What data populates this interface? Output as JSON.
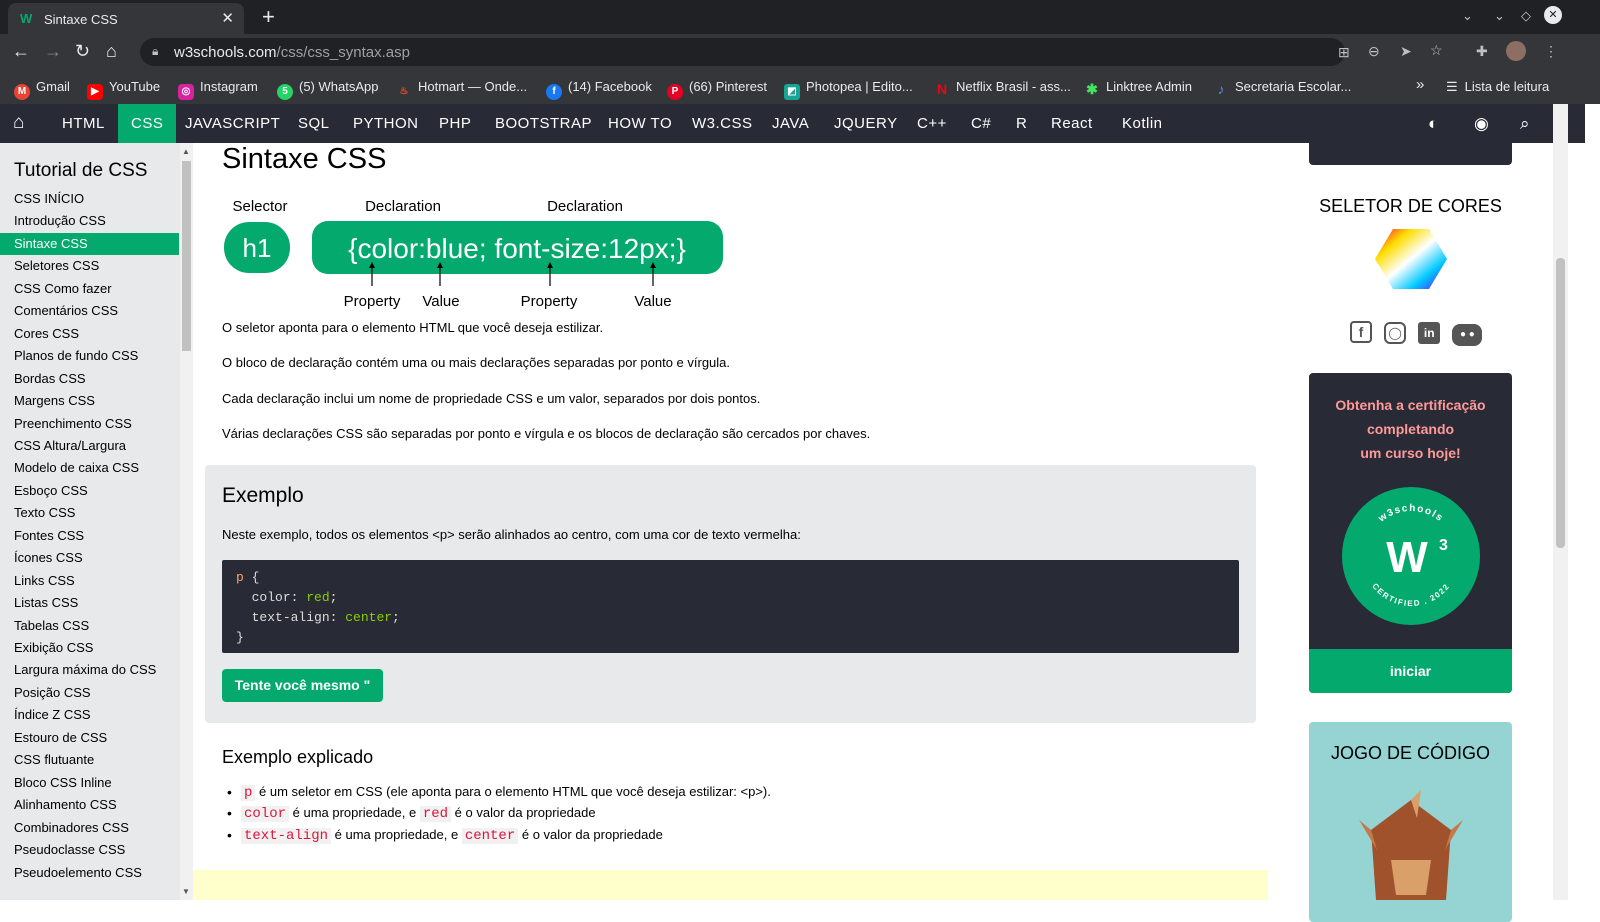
{
  "browser": {
    "tab_title": "Sintaxe CSS",
    "tab_favicon": "W",
    "tab_close": "✕",
    "new_tab": "+",
    "url_domain": "w3schools.com",
    "url_path": "/css/css_syntax.asp",
    "reading_list": "Lista de leitura",
    "bookmarks_more": "»"
  },
  "bookmarks": [
    {
      "label": "Gmail",
      "icon": "gmail-icon",
      "color": "#ea4335",
      "glyph": "M"
    },
    {
      "label": "YouTube",
      "icon": "youtube-icon",
      "color": "#ff0000",
      "glyph": "▶"
    },
    {
      "label": "Instagram",
      "icon": "instagram-icon",
      "color": "#d6249f",
      "glyph": "◎"
    },
    {
      "label": "(5) WhatsApp",
      "icon": "whatsapp-icon",
      "color": "#25d366",
      "glyph": "5"
    },
    {
      "label": "Hotmart — Onde...",
      "icon": "hotmart-icon",
      "color": "#f04e23",
      "glyph": "♨"
    },
    {
      "label": "(14) Facebook",
      "icon": "facebook-icon",
      "color": "#1877f2",
      "glyph": "f"
    },
    {
      "label": "(66) Pinterest",
      "icon": "pinterest-icon",
      "color": "#e60023",
      "glyph": "P"
    },
    {
      "label": "Photopea | Edito...",
      "icon": "photopea-icon",
      "color": "#18a497",
      "glyph": "◩"
    },
    {
      "label": "Netflix Brasil - ass...",
      "icon": "netflix-icon",
      "color": "#e50914",
      "glyph": "N"
    },
    {
      "label": "Linktree Admin",
      "icon": "linktree-icon",
      "color": "#43e660",
      "glyph": "✱"
    },
    {
      "label": "Secretaria Escolar...",
      "icon": "secretaria-icon",
      "color": "#4a90e2",
      "glyph": "♪"
    }
  ],
  "topnav": {
    "items": [
      "HTML",
      "CSS",
      "JAVASCRIPT",
      "SQL",
      "PYTHON",
      "PHP",
      "BOOTSTRAP",
      "HOW TO",
      "W3.CSS",
      "JAVA",
      "JQUERY",
      "C++",
      "C#",
      "R",
      "React",
      "Kotlin"
    ],
    "active": "CSS"
  },
  "sidebar": {
    "title": "Tutorial de CSS",
    "items": [
      "CSS INÍCIO",
      "Introdução CSS",
      "Sintaxe CSS",
      "Seletores CSS",
      "CSS Como fazer",
      "Comentários CSS",
      "Cores CSS",
      "Planos de fundo CSS",
      "Bordas CSS",
      "Margens CSS",
      "Preenchimento CSS",
      "CSS Altura/Largura",
      "Modelo de caixa CSS",
      "Esboço CSS",
      "Texto CSS",
      "Fontes CSS",
      "Ícones CSS",
      "Links CSS",
      "Listas CSS",
      "Tabelas CSS",
      "Exibição CSS",
      "Largura máxima do CSS",
      "Posição CSS",
      "Índice Z CSS",
      "Estouro de CSS",
      "CSS flutuante",
      "Bloco CSS Inline",
      "Alinhamento CSS",
      "Combinadores CSS",
      "Pseudoclasse CSS",
      "Pseudoelemento CSS"
    ],
    "active": "Sintaxe CSS"
  },
  "main": {
    "title": "Sintaxe CSS",
    "diagram": {
      "selector_label": "Selector",
      "declaration_label_1": "Declaration",
      "declaration_label_2": "Declaration",
      "selector": "h1",
      "block": "{color:blue; font-size:12px;}",
      "property_1": "Property",
      "value_1": "Value",
      "property_2": "Property",
      "value_2": "Value",
      "green": "#04aa6d"
    },
    "paragraphs": [
      "O seletor aponta para o elemento HTML que você deseja estilizar.",
      "O bloco de declaração contém uma ou mais declarações separadas por ponto e vírgula.",
      "Cada declaração inclui um nome de propriedade CSS e um valor, separados por dois pontos.",
      "Várias declarações CSS são separadas por ponto e vírgula e os blocos de declaração são cercados por chaves."
    ],
    "example": {
      "title": "Exemplo",
      "description": "Neste exemplo, todos os elementos <p> serão alinhados ao centro, com uma cor de texto vermelha:",
      "code_selector": "p",
      "code_open": " {",
      "line1_prop": "color",
      "line1_val": "red",
      "line2_prop": "text-align",
      "line2_val": "center",
      "code_close": "}",
      "try_button": "Tente você mesmo \""
    },
    "explained": {
      "title": "Exemplo explicado",
      "item1_kw": "p",
      "item1_text": " é um seletor em CSS (ele aponta para o elemento HTML que você deseja estilizar: <p>).",
      "item2_kw1": "color",
      "item2_mid": " é uma propriedade, e ",
      "item2_kw2": "red",
      "item2_end": " é o valor da propriedade",
      "item3_kw1": "text-align",
      "item3_mid": " é uma propriedade, e ",
      "item3_kw2": "center",
      "item3_end": " é o valor da propriedade"
    }
  },
  "right": {
    "color_picker_title": "SELETOR DE CORES",
    "cert_text_1": "Obtenha a certificação",
    "cert_text_2": "completando",
    "cert_text_3": "um curso hoje!",
    "badge_top": "w3schools",
    "badge_bottom": "CERTIFIED . 2022",
    "cert_button": "iniciar",
    "game_title": "JOGO DE CÓDIGO"
  }
}
